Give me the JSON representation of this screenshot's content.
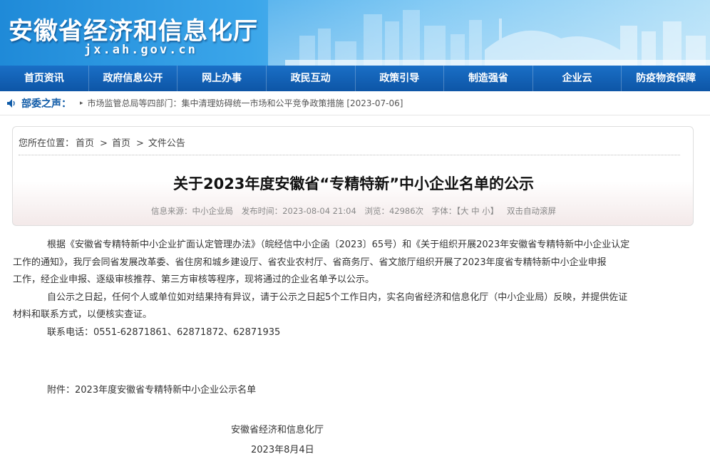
{
  "header": {
    "title": "安徽省经济和信息化厅",
    "domain": "jx.ah.gov.cn"
  },
  "nav": {
    "items": [
      "首页资讯",
      "政府信息公开",
      "网上办事",
      "政民互动",
      "政策引导",
      "制造强省",
      "企业云",
      "防疫物资保障"
    ]
  },
  "ticker": {
    "label": "部委之声：",
    "item": "市场监管总局等四部门：集中清理妨碍统一市场和公平竞争政策措施 [2023-07-06]"
  },
  "breadcrumb": {
    "prefix": "您所在位置：",
    "items": [
      "首页",
      "首页",
      "文件公告"
    ],
    "separator": ">"
  },
  "article": {
    "title": "关于2023年度安徽省“专精特新”中小企业名单的公示",
    "meta": {
      "source": "信息来源：中小企业局",
      "time": "发布时间：2023-08-04 21:04",
      "views": "浏览：42986次",
      "font_label": "字体：",
      "font_sizes": "【大 中 小】",
      "scroll": "双击自动滚屏"
    },
    "paragraphs": {
      "p1_l1": "根据《安徽省专精特新中小企业扩面认定管理办法》（皖经信中小企函〔2023〕65号）和《关于组织开展2023年安徽省专精特新中小企业认定",
      "p1_l2": "工作的通知》，我厅会同省发展改革委、省住房和城乡建设厅、省农业农村厅、省商务厅、省文旅厅组织开展了2023年度省专精特新中小企业申报",
      "p1_l3": "工作，经企业申报、逐级审核推荐、第三方审核等程序，现将通过的企业名单予以公示。",
      "p2_l1": "自公示之日起，任何个人或单位如对结果持有异议，请于公示之日起5个工作日内，实名向省经济和信息化厅（中小企业局）反映，并提供佐证",
      "p2_l2": "材料和联系方式，以便核实查证。",
      "phone": "联系电话：0551-62871861、62871872、62871935"
    },
    "attachment": "附件：2023年度安徽省专精特新中小企业公示名单",
    "signature": "安徽省经济和信息化厅",
    "date": "2023年8月4日"
  },
  "colors": {
    "nav_bg": "#0d55a6",
    "banner_bg": "#3ba6ea",
    "ticker_label": "#0e5aa7"
  }
}
